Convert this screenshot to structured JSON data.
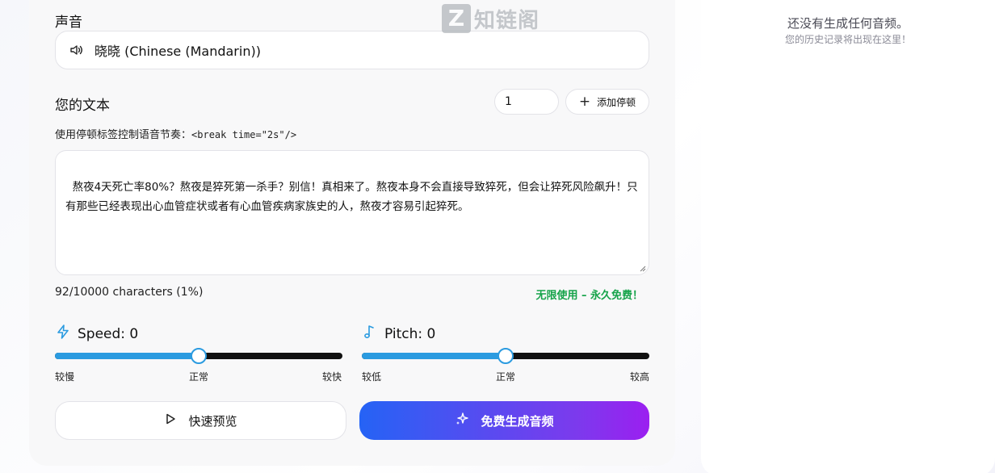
{
  "voice": {
    "section_label": "声音",
    "selected_voice": "晓晓 (Chinese (Mandarin))",
    "icon": "speaker-icon"
  },
  "text_section": {
    "label": "您的文本",
    "pause_value": "1",
    "add_pause_label": "添加停顿",
    "hint_prefix": "使用停顿标签控制语音节奏：",
    "hint_code": "<break time=\"2s\"/>",
    "content": "熬夜4天死亡率80%？熬夜是猝死第一杀手？别信！真相来了。熬夜本身不会直接导致猝死，但会让猝死风险飙升！只有那些已经表现出心血管症状或者有心血管疾病家族史的人，熬夜才容易引起猝死。",
    "char_count": "92/10000 characters (1%)",
    "free_badge": "无限使用 – 永久免费！"
  },
  "speed": {
    "title": "Speed: 0",
    "icon": "lightning-icon",
    "value": 0,
    "position": 0.5,
    "min_label": "较慢",
    "mid_label": "正常",
    "max_label": "较快"
  },
  "pitch": {
    "title": "Pitch: 0",
    "icon": "music-note-icon",
    "value": 0,
    "position": 0.5,
    "min_label": "较低",
    "mid_label": "正常",
    "max_label": "较高"
  },
  "actions": {
    "preview_label": "快速预览",
    "generate_label": "免费生成音频"
  },
  "history": {
    "empty_title": "还没有生成任何音频。",
    "empty_subtitle": "您的历史记录将出现在这里！"
  },
  "watermark": {
    "logo_letter": "Z",
    "brand": "知链阁"
  },
  "colors": {
    "accent": "#2b9be0",
    "success": "#16a34a",
    "gradient_start": "#2563f5",
    "gradient_end": "#9b1ff0"
  }
}
